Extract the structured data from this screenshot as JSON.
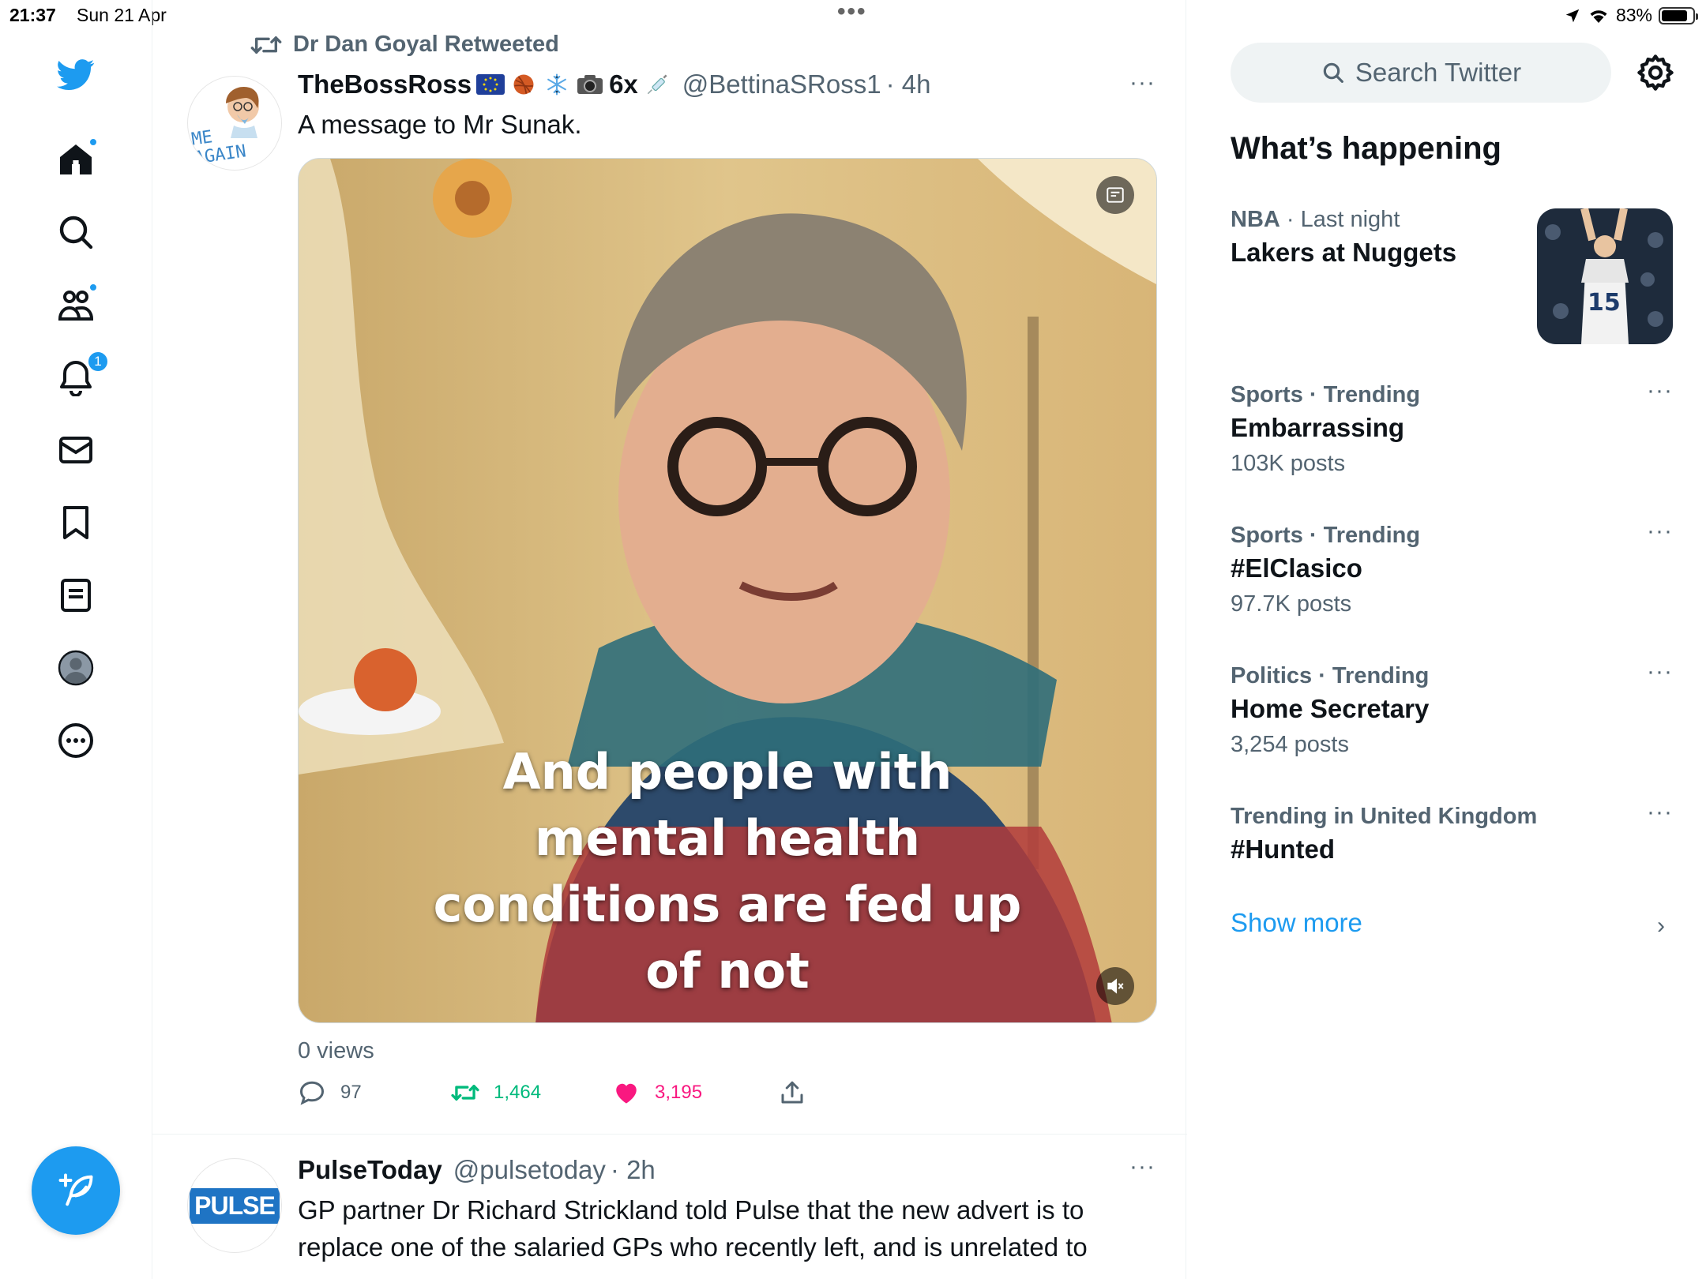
{
  "status_bar": {
    "time": "21:37",
    "date": "Sun 21 Apr",
    "battery": "83%",
    "battery_level": 0.83
  },
  "nav": {
    "items": [
      {
        "name": "home",
        "icon": "home-icon",
        "has_dot": true
      },
      {
        "name": "explore",
        "icon": "search-icon"
      },
      {
        "name": "communities",
        "icon": "communities-icon",
        "has_dot": true
      },
      {
        "name": "notifications",
        "icon": "bell-icon",
        "badge": "1"
      },
      {
        "name": "messages",
        "icon": "mail-icon"
      },
      {
        "name": "bookmarks",
        "icon": "bookmark-icon"
      },
      {
        "name": "lists",
        "icon": "list-icon"
      },
      {
        "name": "profile",
        "icon": "profile-icon"
      },
      {
        "name": "more",
        "icon": "more-circle-icon"
      }
    ],
    "compose_icon": "compose-feather-icon"
  },
  "timeline": {
    "tweets": [
      {
        "retweeted_by": "Dr Dan Goyal Retweeted",
        "display_name": "TheBossRoss",
        "name_suffix": "6x",
        "handle": "@BettinaSRoss1",
        "time": "· 4h",
        "avatar_text": "ME AGAIN",
        "text": "A message to Mr Sunak.",
        "video_caption": "And people with mental health conditions are fed up of not",
        "views": "0 views",
        "replies": "97",
        "retweets": "1,464",
        "likes": "3,195",
        "liked": true,
        "retweeted": true,
        "more": "···"
      },
      {
        "display_name": "PulseToday",
        "handle": "@pulsetoday",
        "time": "· 2h",
        "avatar_text": "PULSE",
        "text": "GP partner Dr Richard Strickland told Pulse that the new advert is to replace one of the salaried GPs who recently left, and is unrelated to",
        "more": "···"
      }
    ]
  },
  "sidebar": {
    "search_placeholder": "Search Twitter",
    "section_title": "What’s happening",
    "trends": [
      {
        "meta_cat": "NBA",
        "meta_rest": " · Last night",
        "title": "Lakers at Nuggets",
        "count": "",
        "image_jersey": "15"
      },
      {
        "meta_cat": "Sports · Trending",
        "meta_rest": "",
        "title": "Embarrassing",
        "count": "103K posts"
      },
      {
        "meta_cat": "Sports · Trending",
        "meta_rest": "",
        "title": "#ElClasico",
        "count": "97.7K posts"
      },
      {
        "meta_cat": "Politics · Trending",
        "meta_rest": "",
        "title": "Home Secretary",
        "count": "3,254 posts"
      },
      {
        "meta_cat": "Trending in United Kingdom",
        "meta_rest": "",
        "title": "#Hunted",
        "count": ""
      }
    ],
    "show_more": "Show more",
    "more": "···"
  },
  "colors": {
    "accent": "#1d9bf0",
    "retweet_green": "#00ba7c",
    "like_pink": "#f91880",
    "secondary_text": "#536471"
  }
}
